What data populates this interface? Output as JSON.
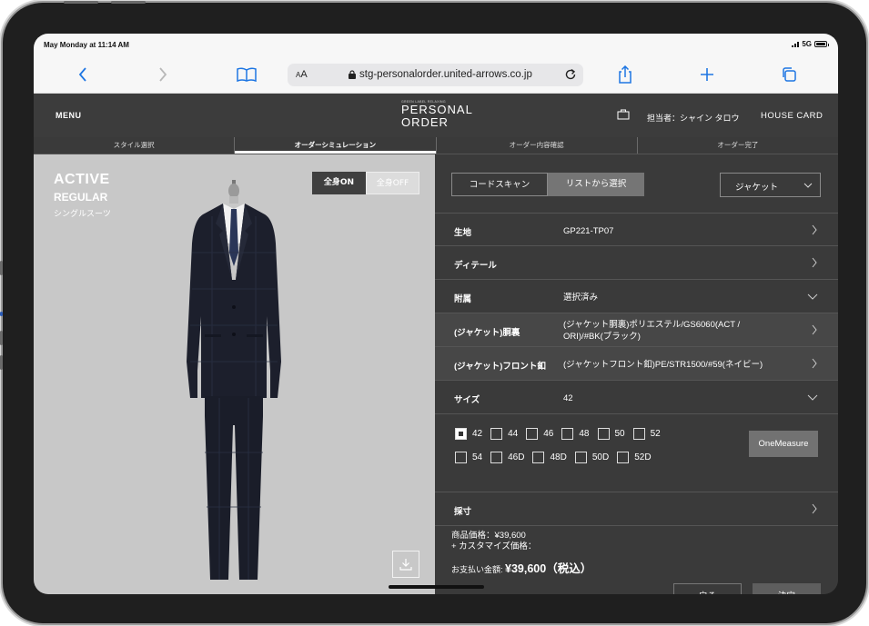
{
  "status_bar": {
    "time": "May Monday at 11:14 AM",
    "network": "5G"
  },
  "browser": {
    "aa_label": "AA",
    "url": "stg-personalorder.united-arrows.co.jp"
  },
  "header": {
    "menu_label": "MENU",
    "logo_top": "GREEN LABEL RELAXING",
    "logo_line1": "PERSONAL",
    "logo_line2": "ORDER",
    "staff_label": "担当者：シャイン タロウ",
    "house_card_label": "HOUSE CARD"
  },
  "steps": [
    {
      "label": "スタイル選択"
    },
    {
      "label": "オーダーシミュレーション"
    },
    {
      "label": "オーダー内容確認"
    },
    {
      "label": "オーダー完了"
    }
  ],
  "model": {
    "title": "ACTIVE",
    "fit": "REGULAR",
    "type": "シングルスーツ",
    "toggle_on": "全身ON",
    "toggle_off": "全身OFF"
  },
  "selection": {
    "code_scan": "コードスキャン",
    "list_select": "リストから選択",
    "category": "ジャケット"
  },
  "rows": [
    {
      "label": "生地",
      "value": "GP221-TP07"
    },
    {
      "label": "ディテール",
      "value": ""
    },
    {
      "label": "附属",
      "value": "選択済み"
    },
    {
      "label": "(ジャケット)胴裏",
      "value": "(ジャケット胴裏)ポリエステル/GS6060(ACT / ORI)/#BK(ブラック)"
    },
    {
      "label": "(ジャケット)フロント釦",
      "value": "(ジャケットフロント釦)PE/STR1500/#59(ネイビー)"
    },
    {
      "label": "サイズ",
      "value": "42"
    },
    {
      "label": "採寸",
      "value": ""
    }
  ],
  "sizes": {
    "line1": [
      "42",
      "44",
      "46",
      "48",
      "50",
      "52"
    ],
    "line2": [
      "54",
      "46D",
      "48D",
      "50D",
      "52D"
    ],
    "selected": "42",
    "one_measure": "OneMeasure"
  },
  "price": {
    "product": "商品価格：¥39,600",
    "customize": "+ カスタマイズ価格：",
    "total_label": "お支払い金額:",
    "total_value": "¥39,600（税込）"
  },
  "actions": {
    "back": "戻る",
    "confirm": "決定"
  },
  "colors": {
    "header": "#3c3c3c",
    "panel": "#3a3a3a",
    "model_bg": "#c8c8c8",
    "link_blue": "#1e76e3"
  }
}
